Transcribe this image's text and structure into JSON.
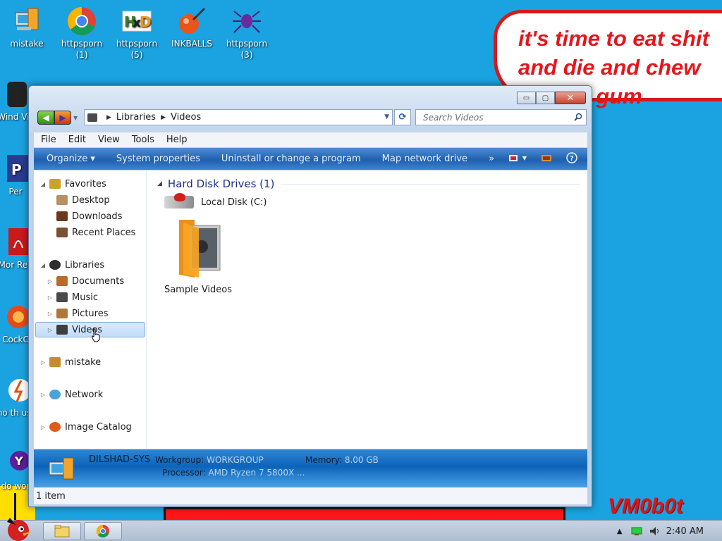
{
  "desktop": {
    "icons": [
      {
        "label": "mistake"
      },
      {
        "label": "httpsporn (1)"
      },
      {
        "label": "httpsporn (5)"
      },
      {
        "label": "INKBALLS"
      },
      {
        "label": "httpsporn (3)"
      },
      {
        "label": "Wind Vis"
      },
      {
        "label": "Per"
      },
      {
        "label": "Mor Rea"
      },
      {
        "label": "CockC"
      },
      {
        "label": "who th uses"
      },
      {
        "label": "do wor"
      }
    ],
    "bubble_text": "it's time to eat shit and die and chew bubble gum",
    "watermark": "VM0b0t"
  },
  "window": {
    "address": {
      "parts": [
        "Libraries",
        "Videos"
      ]
    },
    "search_placeholder": "Search Videos",
    "caption": {
      "minimize": "▭",
      "maximize": "▢",
      "close": "✕"
    },
    "menu": [
      "File",
      "Edit",
      "View",
      "Tools",
      "Help"
    ],
    "commands": [
      "Organize ▾",
      "System properties",
      "Uninstall or change a program",
      "Map network drive",
      "»"
    ],
    "nav_tree": [
      {
        "label": "Favorites",
        "icon": "star-icon"
      },
      {
        "label": "Desktop",
        "icon": "desktop-icon"
      },
      {
        "label": "Downloads",
        "icon": "downloads-icon"
      },
      {
        "label": "Recent Places",
        "icon": "recent-places-icon"
      },
      {
        "label": "Libraries",
        "icon": "libraries-icon"
      },
      {
        "label": "Documents",
        "icon": "documents-icon"
      },
      {
        "label": "Music",
        "icon": "music-icon"
      },
      {
        "label": "Pictures",
        "icon": "pictures-icon"
      },
      {
        "label": "Videos",
        "icon": "videos-icon",
        "selected": true
      },
      {
        "label": "mistake",
        "icon": "computer-icon"
      },
      {
        "label": "Network",
        "icon": "network-icon"
      },
      {
        "label": "Image Catalog",
        "icon": "image-catalog-icon"
      }
    ],
    "content": {
      "group_header": "Hard Disk Drives (1)",
      "drive_label": "Local Disk (C:)",
      "folder_label": "Sample Videos"
    },
    "details": {
      "computer_name": "DILSHAD-SYS",
      "workgroup_label": "Workgroup:",
      "workgroup_value": "WORKGROUP",
      "memory_label": "Memory:",
      "memory_value": "8.00 GB",
      "processor_label": "Processor:",
      "processor_value": "AMD Ryzen 7 5800X ..."
    },
    "status": "1 item"
  },
  "taskbar": {
    "clock": "2:40 AM",
    "tray_expand": "▲"
  }
}
